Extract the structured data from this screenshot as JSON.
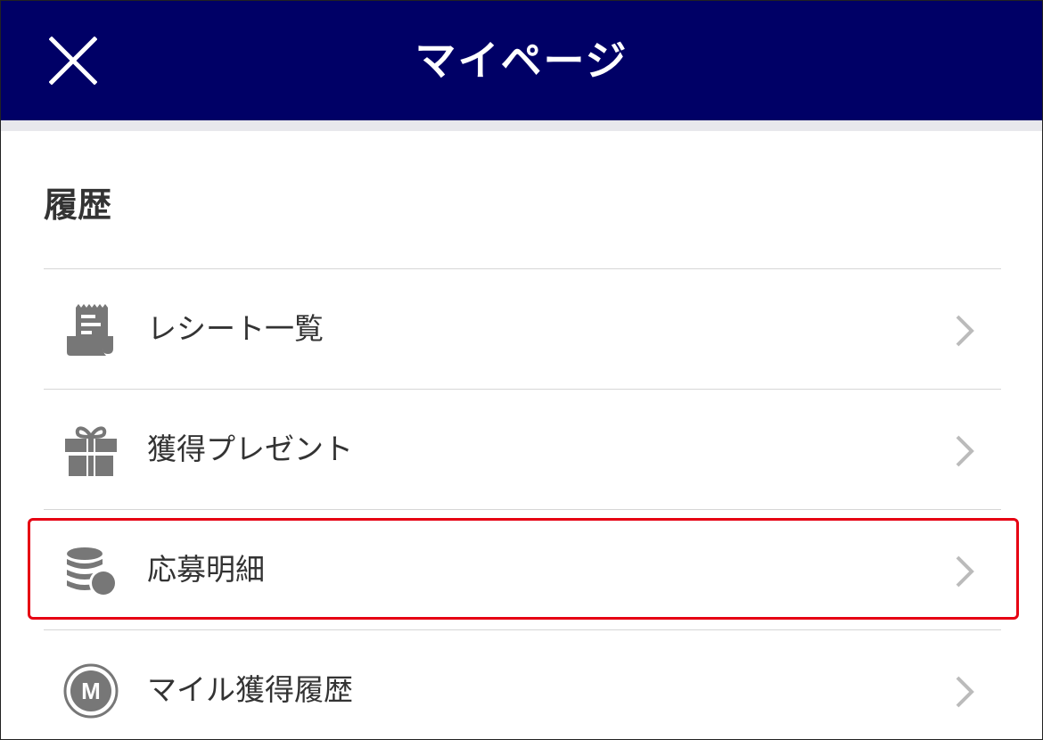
{
  "header": {
    "title": "マイページ",
    "close_icon": "close-icon",
    "background_color": "#000066"
  },
  "section": {
    "title": "履歴"
  },
  "items": [
    {
      "label": "レシート一覧",
      "icon": "receipt-icon"
    },
    {
      "label": "獲得プレゼント",
      "icon": "gift-icon"
    },
    {
      "label": "応募明細",
      "icon": "coins-icon",
      "highlighted": true
    },
    {
      "label": "マイル獲得履歴",
      "icon": "mile-icon",
      "icon_letter": "M"
    }
  ],
  "colors": {
    "highlight": "#e60012",
    "icon": "#777777",
    "chevron": "#bbbbbb"
  }
}
